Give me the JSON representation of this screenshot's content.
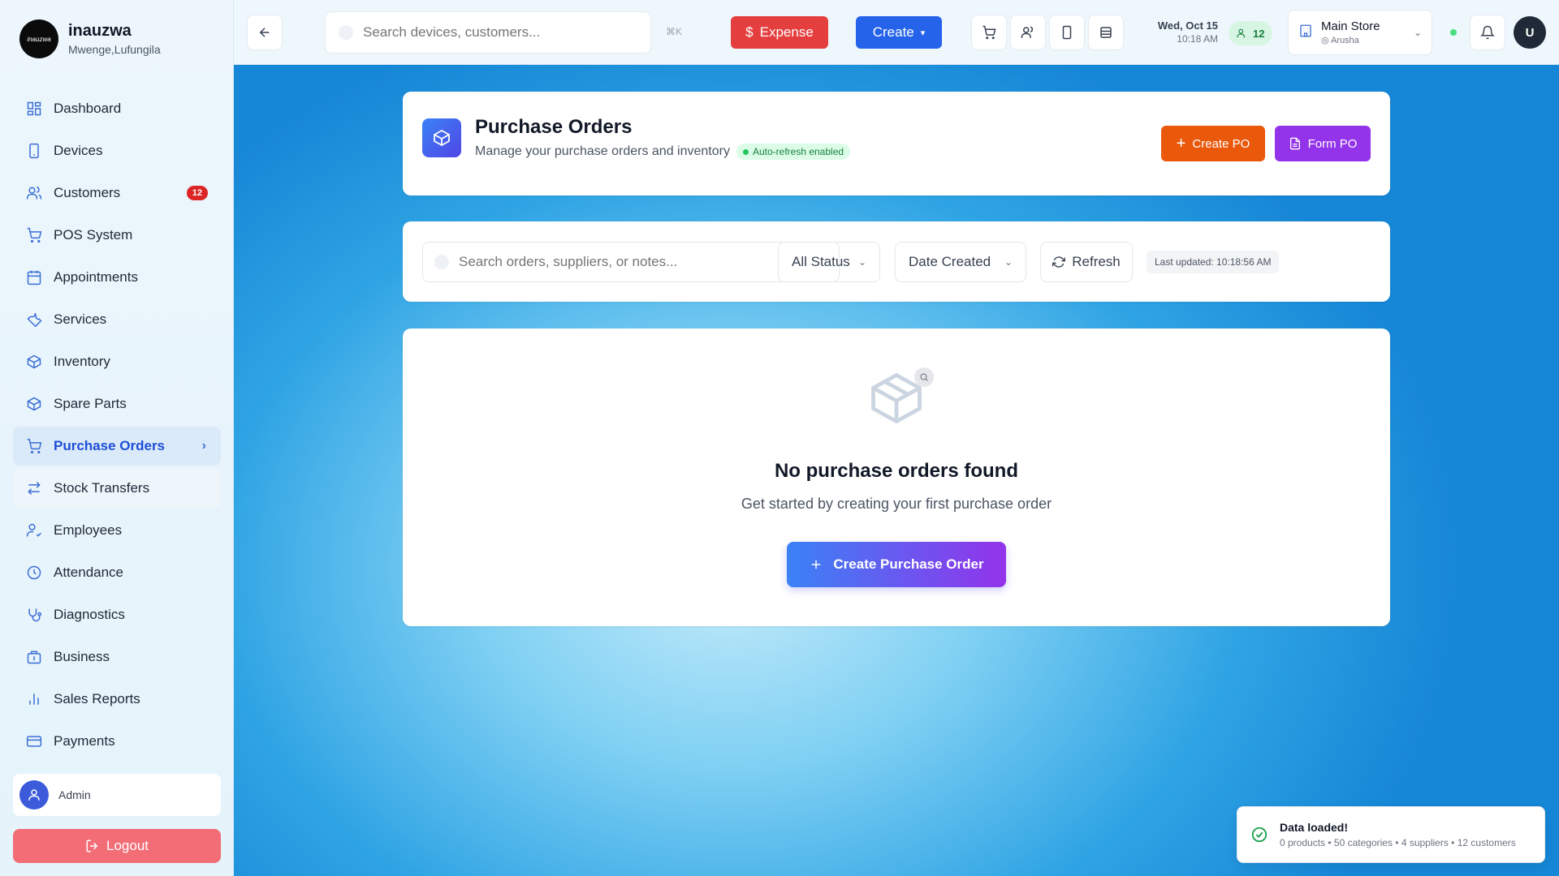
{
  "brand": {
    "logo_text": "inauzwa",
    "name": "inauzwa",
    "location": "Mwenge,Lufungila"
  },
  "sidebar": {
    "items": [
      {
        "label": "Dashboard",
        "icon": "grid-icon"
      },
      {
        "label": "Devices",
        "icon": "phone-icon"
      },
      {
        "label": "Customers",
        "icon": "users-icon",
        "badge": "12"
      },
      {
        "label": "POS System",
        "icon": "cart-icon"
      },
      {
        "label": "Appointments",
        "icon": "calendar-icon"
      },
      {
        "label": "Services",
        "icon": "wrench-icon"
      },
      {
        "label": "Inventory",
        "icon": "box-icon"
      },
      {
        "label": "Spare Parts",
        "icon": "box-icon"
      },
      {
        "label": "Purchase Orders",
        "icon": "cart-icon",
        "active": true
      },
      {
        "label": "Stock Transfers",
        "icon": "transfer-icon"
      },
      {
        "label": "Employees",
        "icon": "user-check-icon"
      },
      {
        "label": "Attendance",
        "icon": "clock-icon"
      },
      {
        "label": "Diagnostics",
        "icon": "stethoscope-icon"
      },
      {
        "label": "Business",
        "icon": "briefcase-icon"
      },
      {
        "label": "Sales Reports",
        "icon": "bar-chart-icon"
      },
      {
        "label": "Payments",
        "icon": "credit-card-icon"
      }
    ],
    "user_name": "Admin",
    "logout_label": "Logout"
  },
  "topbar": {
    "search_placeholder": "Search devices, customers...",
    "shortcut": "⌘K",
    "expense_label": "Expense",
    "create_label": "Create",
    "date": "Wed, Oct 15",
    "time": "10:18 AM",
    "online_count": "12",
    "store_name": "Main Store",
    "store_city": "Arusha",
    "avatar_initial": "U"
  },
  "header": {
    "title": "Purchase Orders",
    "subtitle": "Manage your purchase orders and inventory",
    "auto_refresh": "Auto-refresh enabled",
    "create_po_label": "Create PO",
    "form_po_label": "Form PO"
  },
  "filters": {
    "search_placeholder": "Search orders, suppliers, or notes...",
    "status_label": "All Status",
    "sort_label": "Date Created",
    "refresh_label": "Refresh",
    "last_updated": "Last updated: 10:18:56 AM"
  },
  "empty": {
    "title": "No purchase orders found",
    "subtitle": "Get started by creating your first purchase order",
    "button_label": "Create Purchase Order"
  },
  "toast": {
    "title": "Data loaded!",
    "detail": "0 products • 50 categories • 4 suppliers • 12 customers"
  },
  "colors": {
    "accent": "#2563eb",
    "expense": "#e53e3e",
    "create_po": "#ea580c",
    "form_po": "#9333ea",
    "badge": "#dc2626"
  }
}
